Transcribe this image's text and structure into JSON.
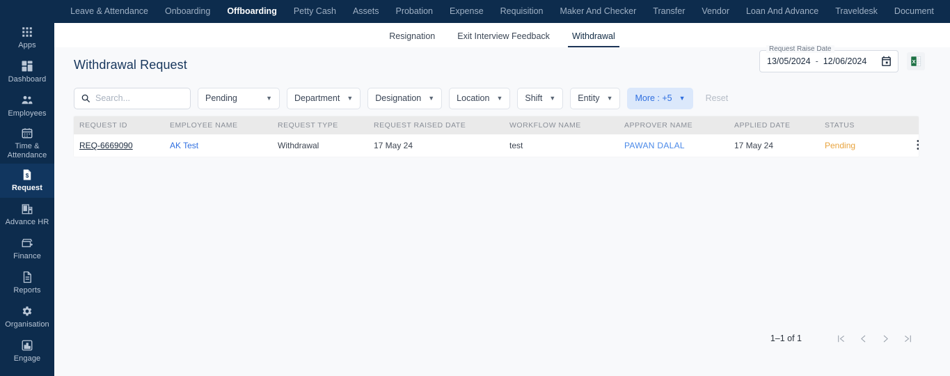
{
  "topnav": {
    "items": [
      {
        "label": "Leave & Attendance",
        "active": false
      },
      {
        "label": "Onboarding",
        "active": false
      },
      {
        "label": "Offboarding",
        "active": true
      },
      {
        "label": "Petty Cash",
        "active": false
      },
      {
        "label": "Assets",
        "active": false
      },
      {
        "label": "Probation",
        "active": false
      },
      {
        "label": "Expense",
        "active": false
      },
      {
        "label": "Requisition",
        "active": false
      },
      {
        "label": "Maker And Checker",
        "active": false
      },
      {
        "label": "Transfer",
        "active": false
      },
      {
        "label": "Vendor",
        "active": false
      },
      {
        "label": "Loan And Advance",
        "active": false
      },
      {
        "label": "Traveldesk",
        "active": false
      },
      {
        "label": "Document",
        "active": false
      }
    ]
  },
  "sidebar": {
    "items": [
      {
        "label": "Apps",
        "icon": "apps-grid-icon",
        "active": false
      },
      {
        "label": "Dashboard",
        "icon": "dashboard-icon",
        "active": false
      },
      {
        "label": "Employees",
        "icon": "people-icon",
        "active": false
      },
      {
        "label": "Time &\nAttendance",
        "icon": "calendar-icon",
        "active": false
      },
      {
        "label": "Request",
        "icon": "request-document-icon",
        "active": true
      },
      {
        "label": "Advance HR",
        "icon": "building-icon",
        "active": false
      },
      {
        "label": "Finance",
        "icon": "finance-icon",
        "active": false
      },
      {
        "label": "Reports",
        "icon": "report-document-icon",
        "active": false
      },
      {
        "label": "Organisation",
        "icon": "gear-icon",
        "active": false
      },
      {
        "label": "Engage",
        "icon": "bar-chart-icon",
        "active": false
      }
    ]
  },
  "tabs": [
    {
      "label": "Resignation",
      "active": false
    },
    {
      "label": "Exit Interview Feedback",
      "active": false
    },
    {
      "label": "Withdrawal",
      "active": true
    }
  ],
  "header": {
    "title": "Withdrawal Request",
    "date_range": {
      "legend": "Request Raise Date",
      "from": "13/05/2024",
      "separator": "-",
      "to": "12/06/2024",
      "calendar_icon": "calendar-icon"
    },
    "export_icon": "excel-export-icon"
  },
  "filters": {
    "search": {
      "value": "",
      "placeholder": "Search..."
    },
    "status": {
      "label": "Pending"
    },
    "dropdowns": [
      {
        "label": "Department"
      },
      {
        "label": "Designation"
      },
      {
        "label": "Location"
      },
      {
        "label": "Shift"
      },
      {
        "label": "Entity"
      }
    ],
    "more": {
      "label": "More : +5"
    },
    "reset": {
      "label": "Reset"
    }
  },
  "table": {
    "columns": [
      "REQUEST ID",
      "EMPLOYEE NAME",
      "REQUEST TYPE",
      "REQUEST RAISED DATE",
      "WORKFLOW NAME",
      "APPROVER NAME",
      "APPLIED DATE",
      "STATUS"
    ],
    "rows": [
      {
        "request_id": "REQ-6669090",
        "employee_name": "AK Test",
        "request_type": "Withdrawal",
        "request_raised_date": "17 May 24",
        "workflow_name": "test",
        "approver_name": "PAWAN DALAL",
        "applied_date": "17 May 24",
        "status": "Pending"
      }
    ]
  },
  "pagination": {
    "range_label": "1–1 of 1",
    "first_label": "|<",
    "prev_label": "<",
    "next_label": ">",
    "last_label": ">|"
  },
  "colors": {
    "navy": "#0d2c4d",
    "active_nav": "#11365f",
    "accent_blue": "#2f6fe0",
    "status_pending": "#e8a33d",
    "page_bg": "#f8f9fb",
    "table_head": "#eaeaea"
  }
}
